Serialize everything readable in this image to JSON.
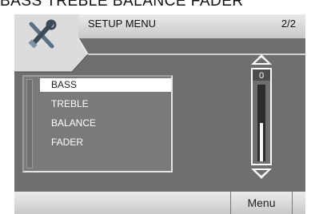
{
  "caption": "BASS TREBLE BALANCE FADER",
  "header": {
    "title": "SETUP MENU",
    "page": "2/2",
    "icon": "tools-icon"
  },
  "menu": {
    "items": [
      "BASS",
      "TREBLE",
      "BALANCE",
      "FADER"
    ],
    "selected": "BASS"
  },
  "slider": {
    "value": "0",
    "level": 0.5
  },
  "footer": {
    "menu_label": "Menu"
  }
}
